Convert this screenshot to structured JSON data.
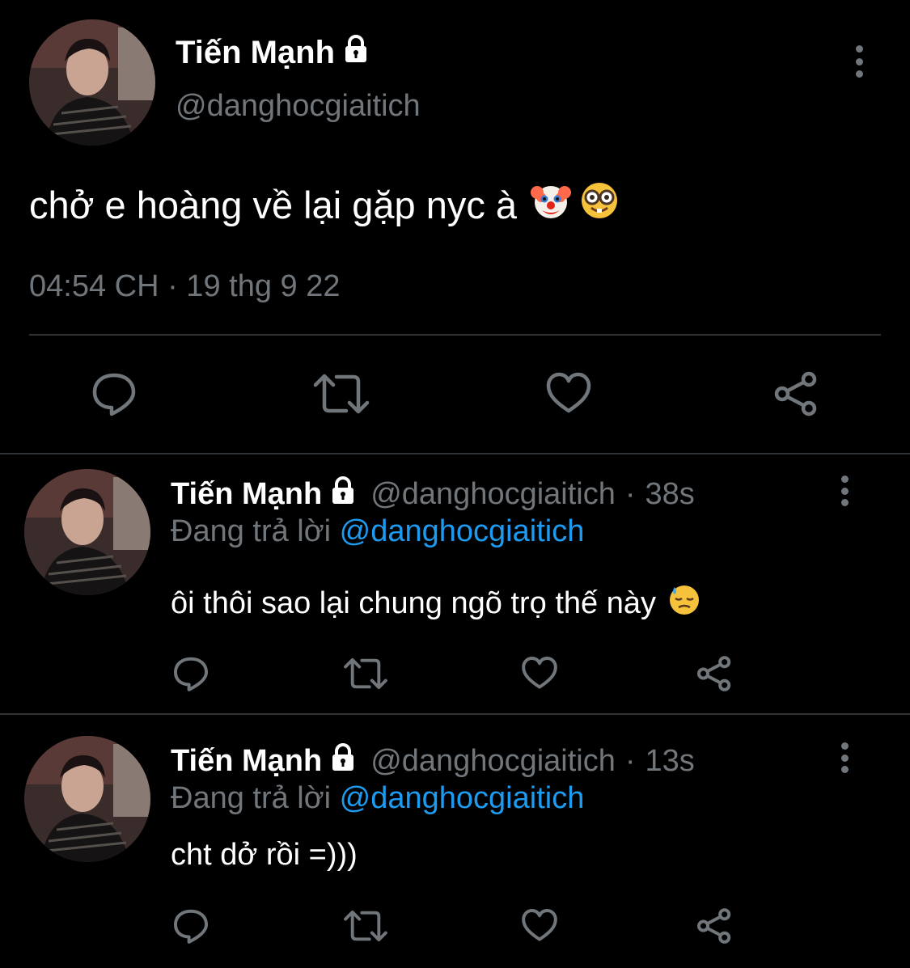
{
  "colors": {
    "background": "#000000",
    "text_primary": "#ffffff",
    "text_secondary": "#71767b",
    "accent_link": "#1d9bf0",
    "divider": "#2f3336"
  },
  "main_tweet": {
    "author_name": "Tiến Mạnh",
    "author_handle": "@danghocgiaitich",
    "protected_icon": "lock-icon",
    "text": "chở e hoàng về lại gặp nyc à",
    "emojis": [
      "clown-face-emoji",
      "nerd-face-emoji"
    ],
    "timestamp": "04:54 CH · 19 thg 9 22",
    "actions": [
      "reply-icon",
      "retweet-icon",
      "like-icon",
      "share-icon"
    ]
  },
  "replies": [
    {
      "author_name": "Tiến Mạnh",
      "author_handle": "@danghocgiaitich",
      "separator": "·",
      "time": "38s",
      "reply_label": "Đang trả lời",
      "reply_to": "@danghocgiaitich",
      "text": "ôi thôi sao lại chung ngõ trọ thế này",
      "emoji": "downcast-face-with-sweat-emoji"
    },
    {
      "author_name": "Tiến Mạnh",
      "author_handle": "@danghocgiaitich",
      "separator": "·",
      "time": "13s",
      "reply_label": "Đang trả lời",
      "reply_to": "@danghocgiaitich",
      "text": "cht dở rồi =)))"
    }
  ]
}
